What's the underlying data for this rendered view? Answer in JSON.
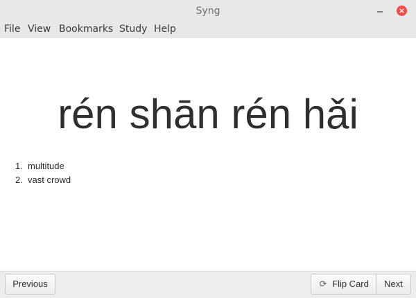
{
  "window": {
    "title": "Syng",
    "close_symbol": "×"
  },
  "menu": {
    "items": [
      {
        "label": "File"
      },
      {
        "label": "View"
      },
      {
        "label": "Bookmarks"
      },
      {
        "label": "Study"
      },
      {
        "label": "Help"
      }
    ]
  },
  "card": {
    "headword": "rén shān rén hǎi",
    "definitions": [
      {
        "num": "1.",
        "text": "multitude"
      },
      {
        "num": "2.",
        "text": "vast crowd"
      }
    ]
  },
  "footer": {
    "previous_label": "Previous",
    "flip_icon_glyph": "⟳",
    "flip_label": "Flip Card",
    "next_label": "Next"
  },
  "colors": {
    "close_button": "#f14b4b",
    "titlebar_bg": "#e8e8e8"
  },
  "icons": {
    "minimize": "minimize-icon",
    "close": "close-icon",
    "flip": "refresh-icon"
  }
}
